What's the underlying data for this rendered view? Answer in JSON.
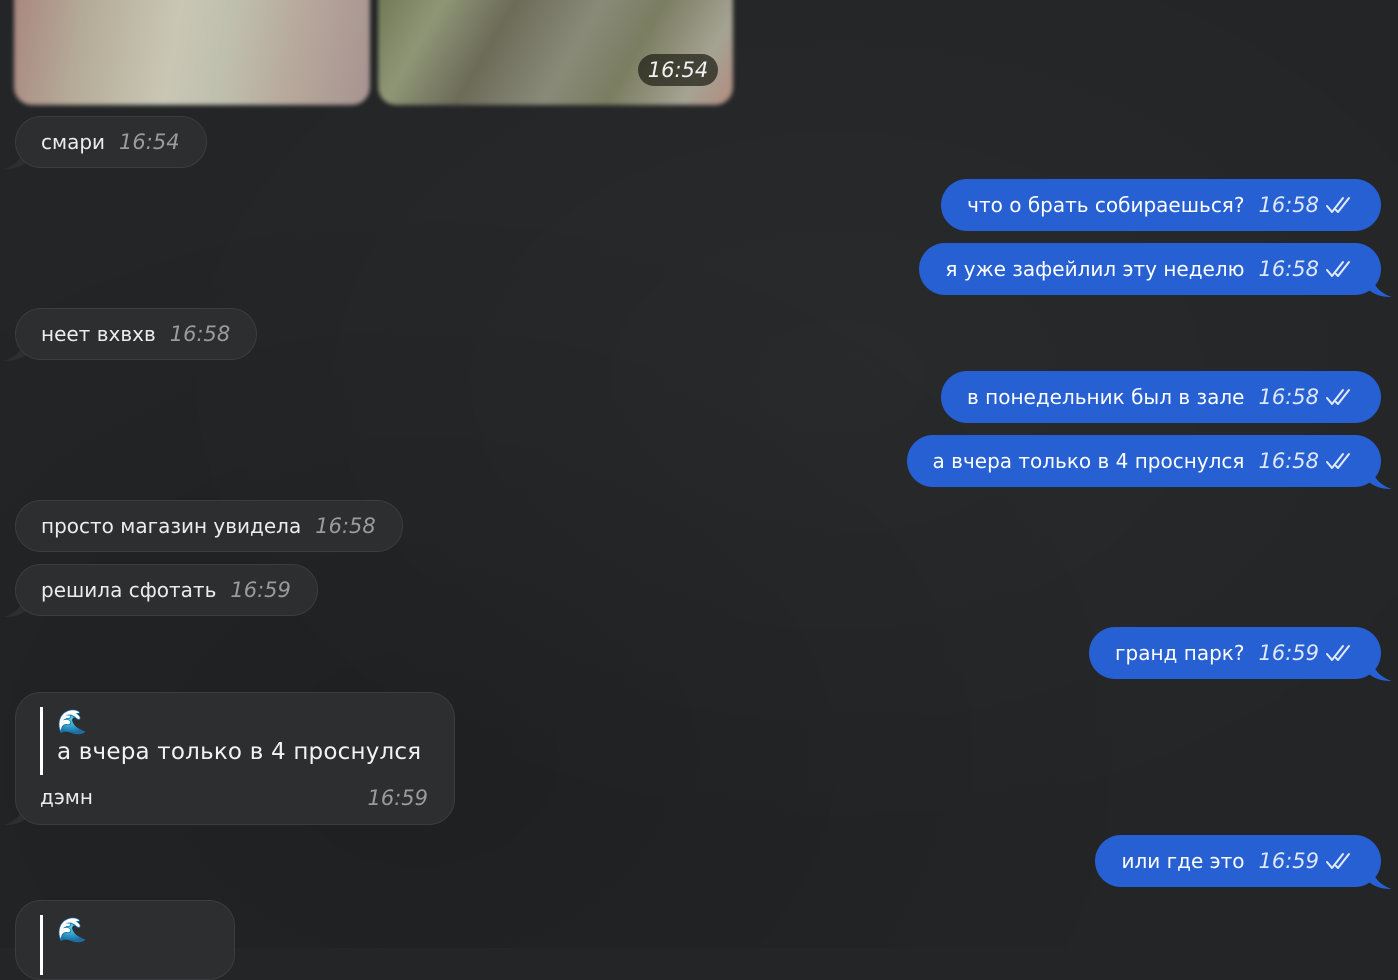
{
  "media": {
    "time": "16:54"
  },
  "messages": [
    {
      "dir": "in",
      "text": "смари",
      "time": "16:54"
    },
    {
      "dir": "out",
      "text": "что  о брать собираешься?",
      "time": "16:58"
    },
    {
      "dir": "out",
      "text": "я уже зафейлил эту неделю",
      "time": "16:58"
    },
    {
      "dir": "in",
      "text": "неет вхвхв",
      "time": "16:58"
    },
    {
      "dir": "out",
      "text": "в понедельник был в зале",
      "time": "16:58"
    },
    {
      "dir": "out",
      "text": "а вчера только в 4 проснулся",
      "time": "16:58"
    },
    {
      "dir": "in",
      "text": "просто магазин увидела",
      "time": "16:58"
    },
    {
      "dir": "in",
      "text": "решила сфотать",
      "time": "16:59"
    },
    {
      "dir": "out",
      "text": "гранд парк?",
      "time": "16:59"
    },
    {
      "dir": "out",
      "text": "или где это",
      "time": "16:59"
    }
  ],
  "replies": [
    {
      "quote_icon": "🌊",
      "quote_text": "а вчера только в 4 проснулся",
      "text": "дэмн",
      "time": "16:59"
    },
    {
      "quote_icon": "🌊"
    }
  ],
  "colors": {
    "background": "#232527",
    "incoming_bubble": "#2d2e30",
    "outgoing_bubble": "#2660d3"
  },
  "icons": {
    "read_status": "double-check-icon"
  }
}
